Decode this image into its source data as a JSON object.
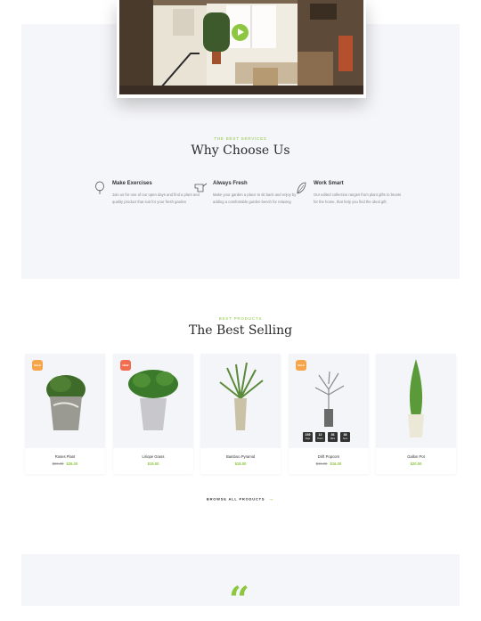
{
  "video": {
    "play_label": "Play video"
  },
  "why": {
    "eyebrow": "The Best Services",
    "title": "Why Choose Us",
    "features": [
      {
        "title": "Make Exercises",
        "text": "Join us for one of our open days and find a plant and quality product that suit for your fresh garden",
        "icon": "tree-icon"
      },
      {
        "title": "Always Fresh",
        "text": "Make your garden a place to sit back and enjoy by adding a comfortable garden bench for relaxing",
        "icon": "watering-can-icon"
      },
      {
        "title": "Work Smart",
        "text": "Our edited collection ranges from plant gifts to brunts for the home, that help you find the ideal gift.",
        "icon": "leaf-icon"
      }
    ]
  },
  "products": {
    "eyebrow": "Best Products",
    "title": "The Best Selling",
    "items": [
      {
        "name": "Roses Plant",
        "old_price": "$30.00",
        "price": "$26.00",
        "badge": "SALE",
        "badge_color": "#f6a54a"
      },
      {
        "name": "Liriope Grass",
        "old_price": "",
        "price": "$19.00",
        "badge": "NEW",
        "badge_color": "#f26d4f"
      },
      {
        "name": "Bamboo Pyramid",
        "old_price": "",
        "price": "$18.00",
        "badge": "",
        "badge_color": ""
      },
      {
        "name": "Drift Popcorn",
        "old_price": "$19.00",
        "price": "$16.00",
        "badge": "SALE",
        "badge_color": "#f6a54a",
        "countdown": [
          {
            "value": "239",
            "unit": "Days"
          },
          {
            "value": "12",
            "unit": "Hours"
          },
          {
            "value": "36",
            "unit": "Mins"
          },
          {
            "value": "38",
            "unit": "Secs"
          }
        ]
      },
      {
        "name": "Gallon Pot",
        "old_price": "",
        "price": "$20.00",
        "badge": "",
        "badge_color": ""
      }
    ],
    "browse_label": "Browse All Products",
    "browse_arrow": "→"
  },
  "testimonial": {
    "quote_mark": "“"
  },
  "colors": {
    "accent": "#8dc63f",
    "section_bg": "#f5f6f9",
    "sale": "#f6a54a",
    "new": "#f26d4f"
  }
}
